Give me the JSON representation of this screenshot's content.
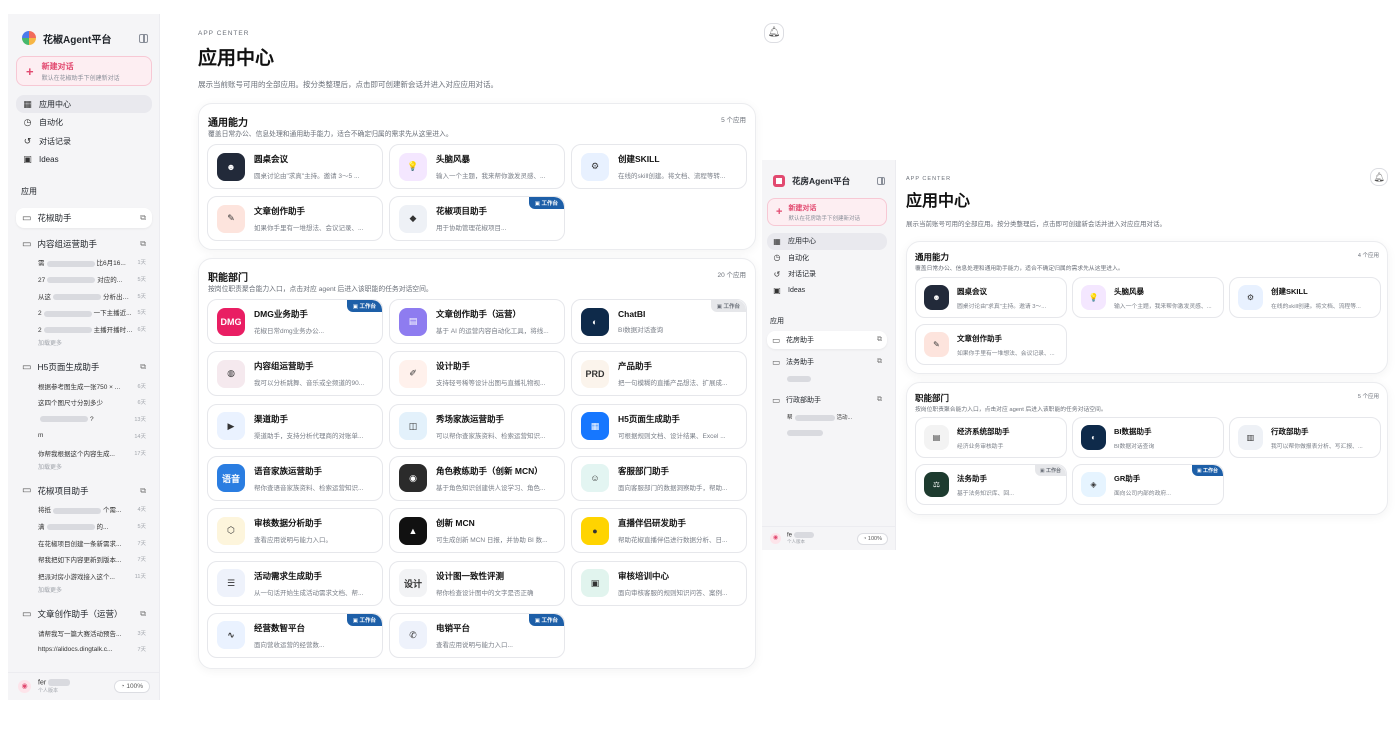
{
  "left": {
    "brand": "花椒Agent平台",
    "new_chat": {
      "title": "新建对话",
      "subtitle": "默认在花椒助手下创建新对话"
    },
    "nav": [
      {
        "label": "应用中心",
        "icon": "grid-icon"
      },
      {
        "label": "自动化",
        "icon": "clock-icon"
      },
      {
        "label": "对话记录",
        "icon": "history-icon"
      },
      {
        "label": "Ideas",
        "icon": "inbox-icon"
      }
    ],
    "apps_section": "应用",
    "app_groups": [
      {
        "name": "花椒助手",
        "subs": []
      },
      {
        "name": "内容组运营助手",
        "subs": [
          {
            "pre": "需",
            "post": "比6月16...",
            "time": "1天"
          },
          {
            "pre": "27",
            "post": "对应的...",
            "time": "5天"
          },
          {
            "pre": "从这",
            "post": "分析出来什...",
            "time": "5天"
          },
          {
            "pre": "2",
            "post": "一下主播近...",
            "time": "5天"
          },
          {
            "pre": "2",
            "post": "主播开播时长...",
            "time": "6天"
          }
        ],
        "more": "加载更多"
      },
      {
        "name": "H5页面生成助手",
        "subs": [
          {
            "pre": "根据参考图生成一张750 × ...",
            "post": "",
            "time": "6天"
          },
          {
            "pre": "这四个图尺寸分别多少",
            "post": "",
            "time": "6天"
          },
          {
            "pre": "",
            "post": "?",
            "time": "13天"
          },
          {
            "pre": "m",
            "post": "",
            "time": "14天"
          },
          {
            "pre": "你帮我根据这个内容生成...",
            "post": "",
            "time": "17天"
          }
        ],
        "more": "加载更多"
      },
      {
        "name": "花椒项目助手",
        "subs": [
          {
            "pre": "将抵",
            "post": "个需...",
            "time": "4天"
          },
          {
            "pre": "满",
            "post": "的...",
            "time": "5天"
          },
          {
            "pre": "在花椒项目创建一条新需求...",
            "post": "",
            "time": "7天"
          },
          {
            "pre": "帮我把如下内容更新到版本...",
            "post": "",
            "time": "7天"
          },
          {
            "pre": "把派对房小游戏接入这个...",
            "post": "",
            "time": "11天"
          }
        ],
        "more": "加载更多"
      },
      {
        "name": "文章创作助手（运营）",
        "subs": [
          {
            "pre": "请帮我写一篇大赛活动预告...",
            "post": "",
            "time": "3天"
          },
          {
            "pre": "https://alidocs.dingtalk.c...",
            "post": "",
            "time": "7天"
          }
        ]
      }
    ],
    "user": {
      "name": "fer",
      "role": "个人版本",
      "zoom": "100%"
    },
    "eyebrow": "APP CENTER",
    "title": "应用中心",
    "desc": "展示当前账号可用的全部应用。按分类整理后，点击即可创建新会话并进入对应应用对话。",
    "panels": [
      {
        "title": "通用能力",
        "count": "5 个应用",
        "desc": "覆盖日常办公、信息处理和通用助手能力，适合不确定归属的需求先从这里进入。",
        "cards": [
          {
            "title": "圆桌会议",
            "desc": "圆桌讨论由\"求真\"主持。邀请 3～5 ...",
            "icon": "roundtable-icon",
            "color": "#222a3a"
          },
          {
            "title": "头脑风暴",
            "desc": "输入一个主题，我来帮你激发灵感、...",
            "icon": "bulb-icon",
            "color": "#f4e7ff"
          },
          {
            "title": "创建SKILL",
            "desc": "在线的skill创建。将文档、流程等转...",
            "icon": "skill-icon",
            "color": "#e8f1ff"
          },
          {
            "title": "文章创作助手",
            "desc": "如果你手里有一堆想法、会议记录、...",
            "icon": "article-icon",
            "color": "#fde4dd"
          },
          {
            "title": "花椒项目助手",
            "desc": "用于协助管理花椒项目...",
            "icon": "project-icon",
            "color": "#eef1f6",
            "badge": "工作台"
          }
        ]
      },
      {
        "title": "职能部门",
        "count": "20 个应用",
        "desc": "按岗位职责聚合能力入口，点击对应 agent 后进入该职能的任务对话空间。",
        "cards": [
          {
            "title": "DMG业务助手",
            "desc": "花椒日常dmg业务办公...",
            "icon": "dmg-icon",
            "color": "#e91e63",
            "text": "DMG",
            "badge": "工作台"
          },
          {
            "title": "文章创作助手（运营）",
            "desc": "基于 AI 的运营内容自动化工具，将线...",
            "icon": "writing-icon",
            "color": "#8e7cf0"
          },
          {
            "title": "ChatBI",
            "desc": "BI数据对话查询",
            "icon": "chart-icon",
            "color": "#0e2a4a",
            "badge_gray": "工作台"
          },
          {
            "title": "内容组运营助手",
            "desc": "我可以分析跳舞、音乐或全频道的90...",
            "icon": "content-icon",
            "color": "#f5e9ee"
          },
          {
            "title": "设计助手",
            "desc": "支持轻号稀等设计出图与直播礼物视...",
            "icon": "design-icon",
            "color": "#fff1ec"
          },
          {
            "title": "产品助手",
            "desc": "把一句模糊的直播产品想法、扩展成...",
            "icon": "product-icon",
            "color": "#fbf4ec",
            "text": "PRD"
          },
          {
            "title": "渠道助手",
            "desc": "渠道助手，支持分析代理商的对账单...",
            "icon": "channel-icon",
            "color": "#eaf2ff"
          },
          {
            "title": "秀场家族运营助手",
            "desc": "可以帮你查家族资料、检索运营知识...",
            "icon": "family-icon",
            "color": "#e3f1fb"
          },
          {
            "title": "H5页面生成助手",
            "desc": "可根据规则文档、设计结果、Excel ...",
            "icon": "h5-icon",
            "color": "#1677ff"
          },
          {
            "title": "语音家族运营助手",
            "desc": "帮你查语音家族资料、检索运营知识...",
            "icon": "voice-icon",
            "color": "#2a7de1",
            "text": "语音"
          },
          {
            "title": "角色教练助手（创新 MCN）",
            "desc": "基于角色知识创建供人设学习、角色...",
            "icon": "coach-icon",
            "color": "#2b2b2b"
          },
          {
            "title": "客服部门助手",
            "desc": "面向客服部门的数据洞察助手，帮助...",
            "icon": "service-icon",
            "color": "#e3f5f2"
          },
          {
            "title": "审核数据分析助手",
            "desc": "查看应用说明与能力入口。",
            "icon": "audit-icon",
            "color": "#fdf5dc"
          },
          {
            "title": "创新 MCN",
            "desc": "可生成创新 MCN 日报，并协助 BI 数...",
            "icon": "mcn-icon",
            "color": "#111111"
          },
          {
            "title": "直播伴侣研发助手",
            "desc": "帮助花椒直播伴侣进行数据分析、日...",
            "icon": "companion-icon",
            "color": "#ffd400"
          },
          {
            "title": "活动需求生成助手",
            "desc": "从一句话开始生成活动需求文档、帮...",
            "icon": "activity-icon",
            "color": "#eef2fb"
          },
          {
            "title": "设计图一致性评测",
            "desc": "帮你检查设计图中的文字是否正确",
            "icon": "design-check-icon",
            "color": "#f2f3f5",
            "text": "设计"
          },
          {
            "title": "审核培训中心",
            "desc": "面向审核客服的规则知识问答、案例...",
            "icon": "training-icon",
            "color": "#e1f4ee"
          },
          {
            "title": "经营数智平台",
            "desc": "面向营收运营的经营数...",
            "icon": "business-icon",
            "color": "#eaf2ff",
            "badge": "工作台"
          },
          {
            "title": "电销平台",
            "desc": "查看应用说明与能力入口...",
            "icon": "telesales-icon",
            "color": "#eef2fb",
            "badge": "工作台"
          }
        ]
      }
    ]
  },
  "right": {
    "brand": "花房Agent平台",
    "new_chat": {
      "title": "新建对话",
      "subtitle": "默认在花房助手下创建新对话"
    },
    "nav": [
      {
        "label": "应用中心",
        "icon": "grid-icon"
      },
      {
        "label": "自动化",
        "icon": "clock-icon"
      },
      {
        "label": "对话记录",
        "icon": "history-icon"
      },
      {
        "label": "Ideas",
        "icon": "inbox-icon"
      }
    ],
    "apps_section": "应用",
    "app_groups": [
      {
        "name": "花房助手",
        "subs": []
      },
      {
        "name": "法务助手",
        "subs": []
      },
      {
        "name": "行政部助手",
        "subs": [
          {
            "pre": "帮",
            "post": "活动...",
            "time": ""
          }
        ]
      }
    ],
    "user": {
      "name": "fe",
      "role": "个人版本",
      "zoom": "100%"
    },
    "eyebrow": "APP CENTER",
    "title": "应用中心",
    "desc": "展示当前账号可用的全部应用。按分类整理后，点击即可创建新会话并进入对应应用对话。",
    "panels": [
      {
        "title": "通用能力",
        "count": "4 个应用",
        "desc": "覆盖日常办公、信息处理和通用助手能力，适合不确定归属的需求先从这里进入。",
        "cards": [
          {
            "title": "圆桌会议",
            "desc": "圆桌讨论由\"求真\"主持。邀请 3～...",
            "icon": "roundtable-icon",
            "color": "#222a3a"
          },
          {
            "title": "头脑风暴",
            "desc": "输入一个主题，我来帮你激发灵感、...",
            "icon": "bulb-icon",
            "color": "#f4e7ff"
          },
          {
            "title": "创建SKILL",
            "desc": "在线的skill创建。将文档、流程等...",
            "icon": "skill-icon",
            "color": "#e8f1ff"
          },
          {
            "title": "文章创作助手",
            "desc": "如果你手里有一堆想法、会议记录、...",
            "icon": "article-icon",
            "color": "#fde4dd"
          }
        ]
      },
      {
        "title": "职能部门",
        "count": "5 个应用",
        "desc": "按岗位职责聚合能力入口，点击对应 agent 后进入该职能的任务对话空间。",
        "cards": [
          {
            "title": "经济系统部助手",
            "desc": "经济业务审核助手",
            "icon": "economy-icon",
            "color": "#f3f3f3"
          },
          {
            "title": "BI数据助手",
            "desc": "BI数据对话查询",
            "icon": "chart-icon",
            "color": "#0e2a4a"
          },
          {
            "title": "行政部助手",
            "desc": "我可以帮你做报表分析、写汇报、...",
            "icon": "admin-icon",
            "color": "#eef1f6"
          },
          {
            "title": "法务助手",
            "desc": "基于法务知识库、回...",
            "icon": "legal-icon",
            "color": "#1d3b2f",
            "badge_gray": "工作台"
          },
          {
            "title": "GR助手",
            "desc": "面向公司内部的政府...",
            "icon": "gr-icon",
            "color": "#e6f4ff",
            "badge": "工作台"
          }
        ]
      }
    ]
  }
}
